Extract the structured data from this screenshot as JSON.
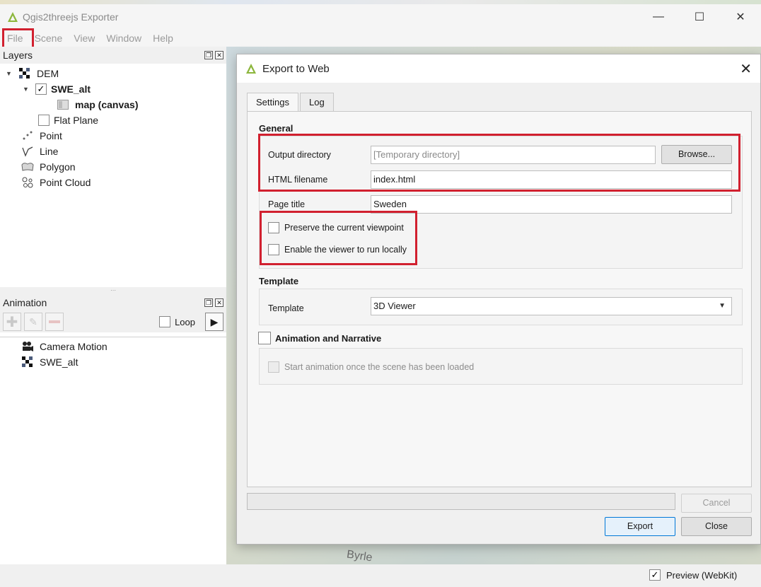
{
  "window": {
    "title": "Qgis2threejs Exporter"
  },
  "menu": [
    "File",
    "Scene",
    "View",
    "Window",
    "Help"
  ],
  "layers_panel": {
    "title": "Layers",
    "items": {
      "dem": "DEM",
      "swe_alt": "SWE_alt",
      "map_canvas": "map (canvas)",
      "flat_plane": "Flat Plane",
      "point": "Point",
      "line": "Line",
      "polygon": "Polygon",
      "point_cloud": "Point Cloud"
    }
  },
  "animation_panel": {
    "title": "Animation",
    "loop_label": "Loop",
    "items": [
      "Camera Motion",
      "SWE_alt"
    ]
  },
  "map": {
    "label": "Byrle"
  },
  "dialog": {
    "title": "Export to Web",
    "tabs": [
      "Settings",
      "Log"
    ],
    "general": {
      "heading": "General",
      "output_dir_label": "Output directory",
      "output_dir_placeholder": "[Temporary directory]",
      "browse_label": "Browse...",
      "html_filename_label": "HTML filename",
      "html_filename_value": "index.html",
      "page_title_label": "Page title",
      "page_title_value": "Sweden",
      "preserve_viewpoint_label": "Preserve the current viewpoint",
      "preserve_viewpoint_checked": false,
      "run_locally_label": "Enable the viewer to run locally",
      "run_locally_checked": false
    },
    "template": {
      "heading": "Template",
      "label": "Template",
      "selected": "3D Viewer"
    },
    "animation": {
      "heading": "Animation and Narrative",
      "checked": false,
      "start_label": "Start animation once the scene has been loaded"
    },
    "buttons": {
      "cancel": "Cancel",
      "export": "Export",
      "close": "Close"
    }
  },
  "statusbar": {
    "preview_label": "Preview (WebKit)",
    "preview_checked": true
  },
  "colors": {
    "highlight_red": "#d1202f",
    "qgis_green": "#8cb63c",
    "accent_blue": "#0078d7"
  }
}
